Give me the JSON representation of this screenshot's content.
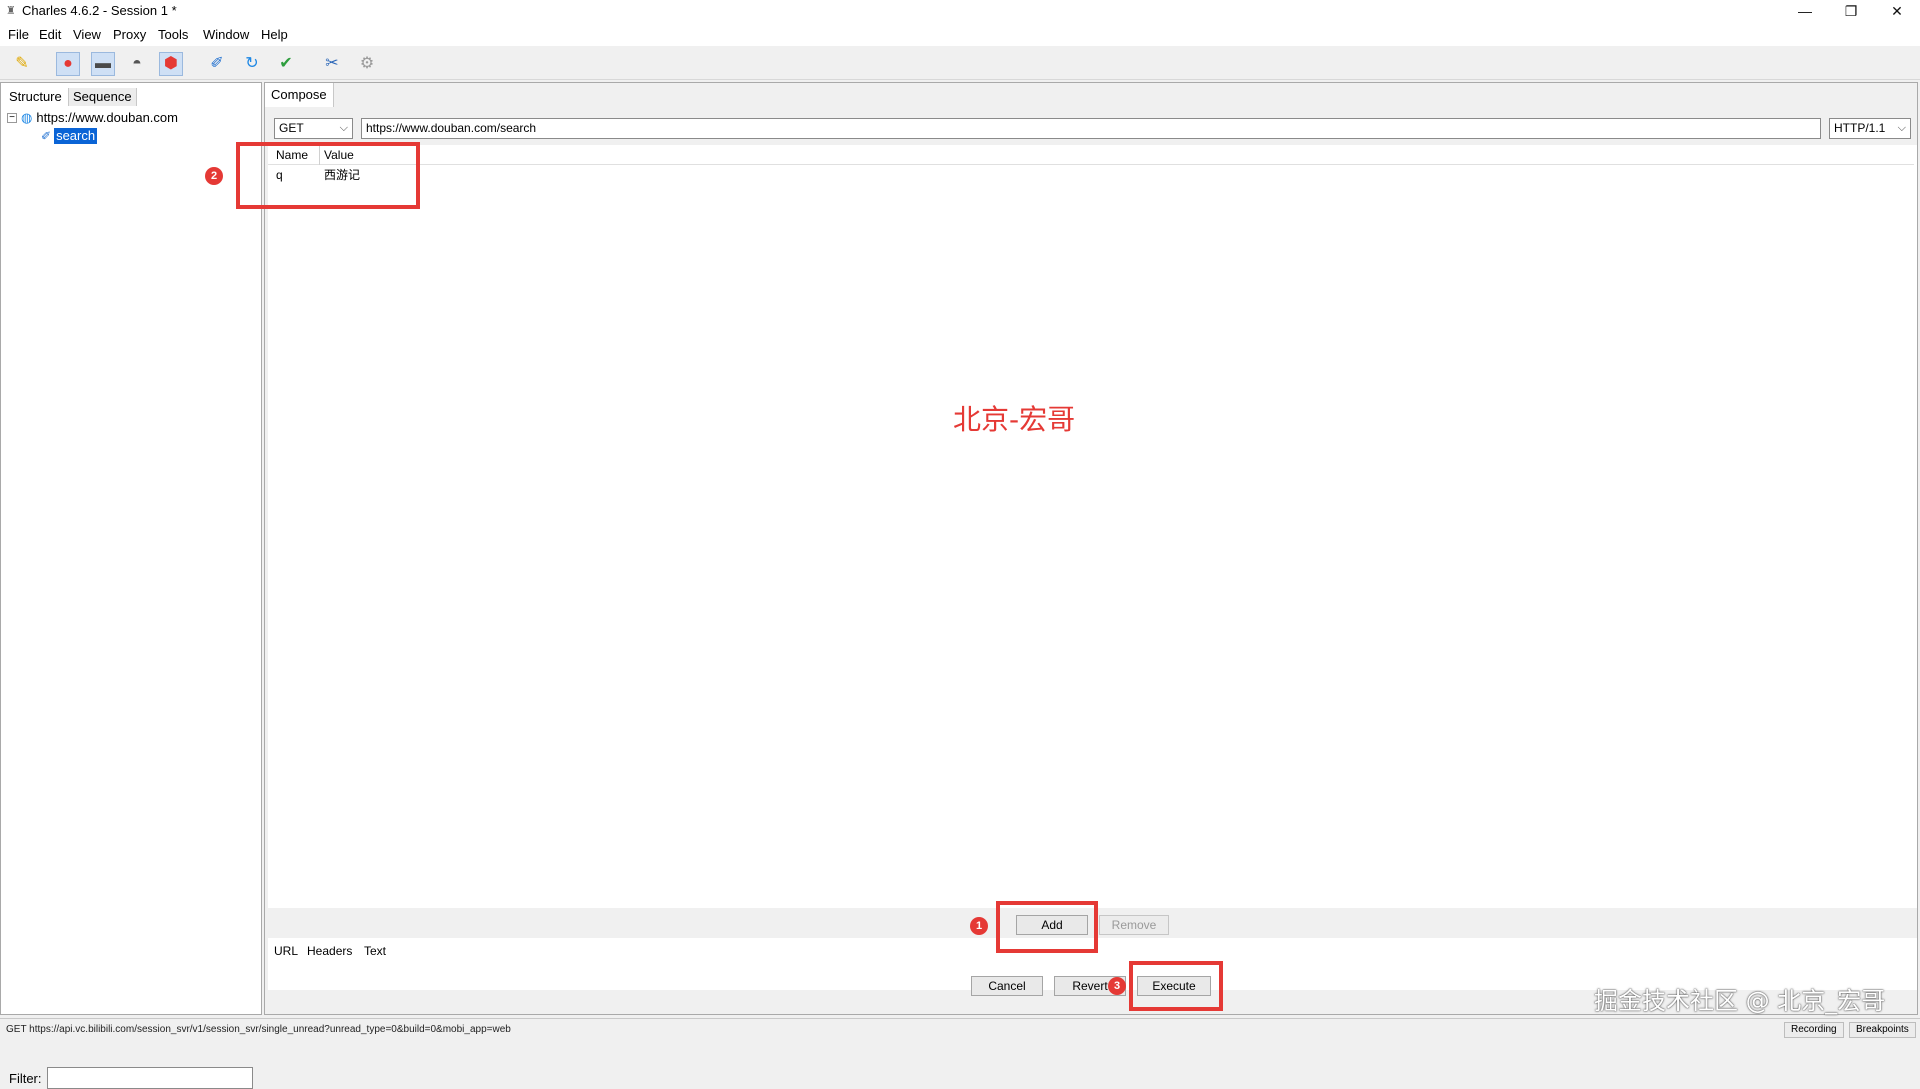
{
  "window": {
    "title": "Charles 4.6.2 - Session 1 *",
    "controls": {
      "minimize": "—",
      "restore": "❐",
      "close": "✕"
    }
  },
  "menubar": {
    "items": [
      "File",
      "Edit",
      "View",
      "Proxy",
      "Tools",
      "Window",
      "Help"
    ]
  },
  "toolbar": {
    "icons": [
      "broom-icon",
      "record-icon",
      "throttle-icon",
      "turtle-icon",
      "breakpoint-icon",
      "compose-icon",
      "repeat-icon",
      "validate-icon",
      "tools-icon",
      "settings-icon"
    ]
  },
  "left_panel": {
    "tabs": [
      "Structure",
      "Sequence"
    ],
    "tree": {
      "host": "https://www.douban.com",
      "child": "search"
    },
    "filter_label": "Filter:",
    "filter_value": ""
  },
  "compose": {
    "tab_label": "Compose",
    "method": "GET",
    "url": "https://www.douban.com/search",
    "protocol": "HTTP/1.1",
    "params": {
      "columns": [
        "Name",
        "Value"
      ],
      "rows": [
        {
          "name": "q",
          "value": "西游记"
        }
      ]
    },
    "buttons": {
      "add": "Add",
      "remove": "Remove"
    },
    "bottom_tabs": [
      "URL",
      "Headers",
      "Text"
    ],
    "actions": {
      "cancel": "Cancel",
      "revert": "Revert",
      "execute": "Execute"
    }
  },
  "annotations": {
    "watermark": "北京-宏哥",
    "badges": [
      "1",
      "2",
      "3"
    ],
    "color": "#e53935"
  },
  "statusbar": {
    "text": "GET https://api.vc.bilibili.com/session_svr/v1/session_svr/single_unread?unread_type=0&build=0&mobi_app=web",
    "chips": [
      "Recording",
      "Breakpoints"
    ],
    "watermark": "掘金技术社区 @ 北京_宏哥"
  }
}
